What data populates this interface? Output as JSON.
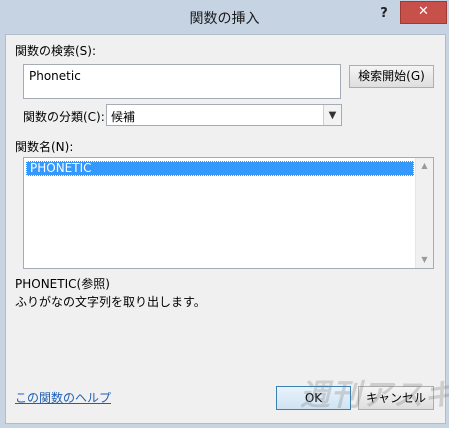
{
  "window": {
    "title": "関数の挿入",
    "help_label": "?",
    "close_label": "✕"
  },
  "search": {
    "label": "関数の検索(S):",
    "value": "Phonetic",
    "button_label": "検索開始(G)"
  },
  "category": {
    "label": "関数の分類(C):",
    "selected": "候補"
  },
  "function_list": {
    "label": "関数名(N):",
    "items": [
      "PHONETIC"
    ]
  },
  "description": {
    "signature": "PHONETIC(参照)",
    "text": "ふりがなの文字列を取り出します。"
  },
  "footer": {
    "help_link": "この関数のヘルプ",
    "ok_label": "OK",
    "cancel_label": "キャンセル"
  },
  "watermark": "週刊アスキー"
}
